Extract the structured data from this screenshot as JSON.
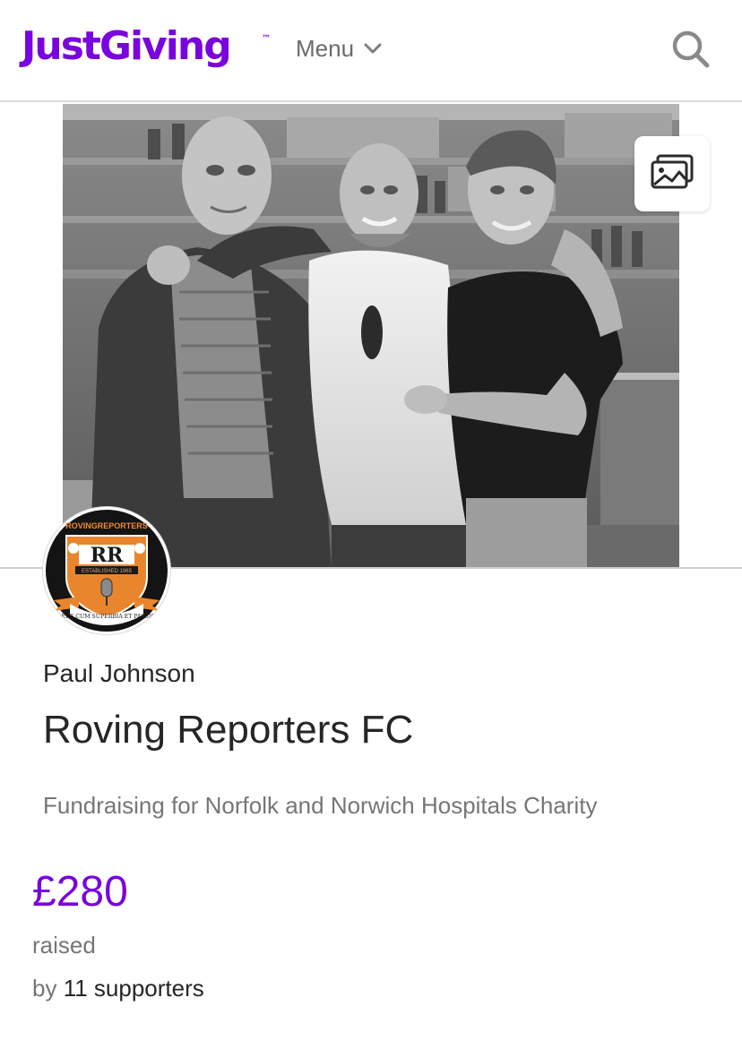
{
  "header": {
    "logo_text": "JustGiving",
    "logo_tm": "™",
    "menu_label": "Menu",
    "menu_icon": "chevron-down-icon",
    "search_icon": "search-icon",
    "brand_color": "#7a04dd"
  },
  "hero": {
    "gallery_icon": "image-gallery-icon"
  },
  "avatar": {
    "badge_top_text": "ROVINGREPORTERS",
    "badge_initials": "RR",
    "badge_established": "ESTABLISHED 1965",
    "badge_motto": "LUDERE CUM SUPERBIA ET PASSIONE"
  },
  "page": {
    "organiser": "Paul Johnson",
    "title": "Roving Reporters FC",
    "charity_line": "Fundraising for Norfolk and Norwich Hospitals Charity"
  },
  "totals": {
    "amount": "£280",
    "raised_label": "raised",
    "by_label": "by",
    "supporters": "11 supporters"
  }
}
